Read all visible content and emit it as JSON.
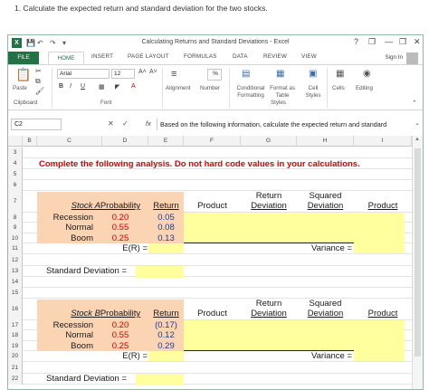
{
  "question": "1. Calculate the expected return and standard deviation for the two stocks.",
  "window": {
    "title": "Calculating Returns and Standard Deviations - Excel",
    "controls": [
      "?",
      "❐",
      "—",
      "❐",
      "✕"
    ]
  },
  "tabs": [
    "FILE",
    "HOME",
    "INSERT",
    "PAGE LAYOUT",
    "FORMULAS",
    "DATA",
    "REVIEW",
    "VIEW"
  ],
  "signin": "Sign In",
  "ribbon": {
    "paste": "Paste",
    "clipboard": "Clipboard",
    "font_name": "Arial",
    "font_size": "12",
    "font_group": "Font",
    "alignment": "Alignment",
    "number": "Number",
    "conditional_formatting": "Conditional Formatting",
    "format_as_table": "Format as Table",
    "cell_styles": "Cell Styles",
    "styles_group": "Styles",
    "cells": "Cells",
    "editing": "Editing",
    "bold": "B",
    "italic": "I",
    "underline": "U",
    "grow_font": "A˄",
    "shrink_font": "A˅",
    "percent": "%"
  },
  "formula_bar": {
    "name_box": "C2",
    "formula": "Based on the following information, calculate the expected return and standard"
  },
  "columns": [
    "B",
    "C",
    "D",
    "E",
    "F",
    "G",
    "H",
    "I"
  ],
  "rows": [
    "3",
    "4",
    "5",
    "6",
    "7",
    "8",
    "9",
    "10",
    "11",
    "12",
    "13",
    "14",
    "15",
    "16",
    "17",
    "18",
    "19",
    "20",
    "21",
    "22"
  ],
  "sheet": {
    "instruction": "Complete the following analysis. Do not hard code values in your calculations.",
    "headers": {
      "product": "Product",
      "return_deviation": [
        "Return",
        "Deviation"
      ],
      "squared_deviation": [
        "Squared",
        "Deviation"
      ]
    },
    "stock_a": {
      "label": "Stock A",
      "probability": "Probability",
      "return": "Return",
      "rows": [
        {
          "state": "Recession",
          "probability": "0.20",
          "return": "0.05"
        },
        {
          "state": "Normal",
          "probability": "0.55",
          "return": "0.08"
        },
        {
          "state": "Boom",
          "probability": "0.25",
          "return": "0.13"
        }
      ]
    },
    "stock_b": {
      "label": "Stock B",
      "probability": "Probability",
      "return": "Return",
      "rows": [
        {
          "state": "Recession",
          "probability": "0.20",
          "return": "(0.17)"
        },
        {
          "state": "Normal",
          "probability": "0.55",
          "return": "0.12"
        },
        {
          "state": "Boom",
          "probability": "0.25",
          "return": "0.29"
        }
      ]
    },
    "er_label": "E(R) =",
    "variance_label": "Variance =",
    "std_label": "Standard Deviation ="
  },
  "colors": {
    "excel_green": "#217346",
    "orange_fill": "#fbd4b4",
    "yellow_fill": "#ffff9e",
    "instruction_red": "#e00000"
  }
}
